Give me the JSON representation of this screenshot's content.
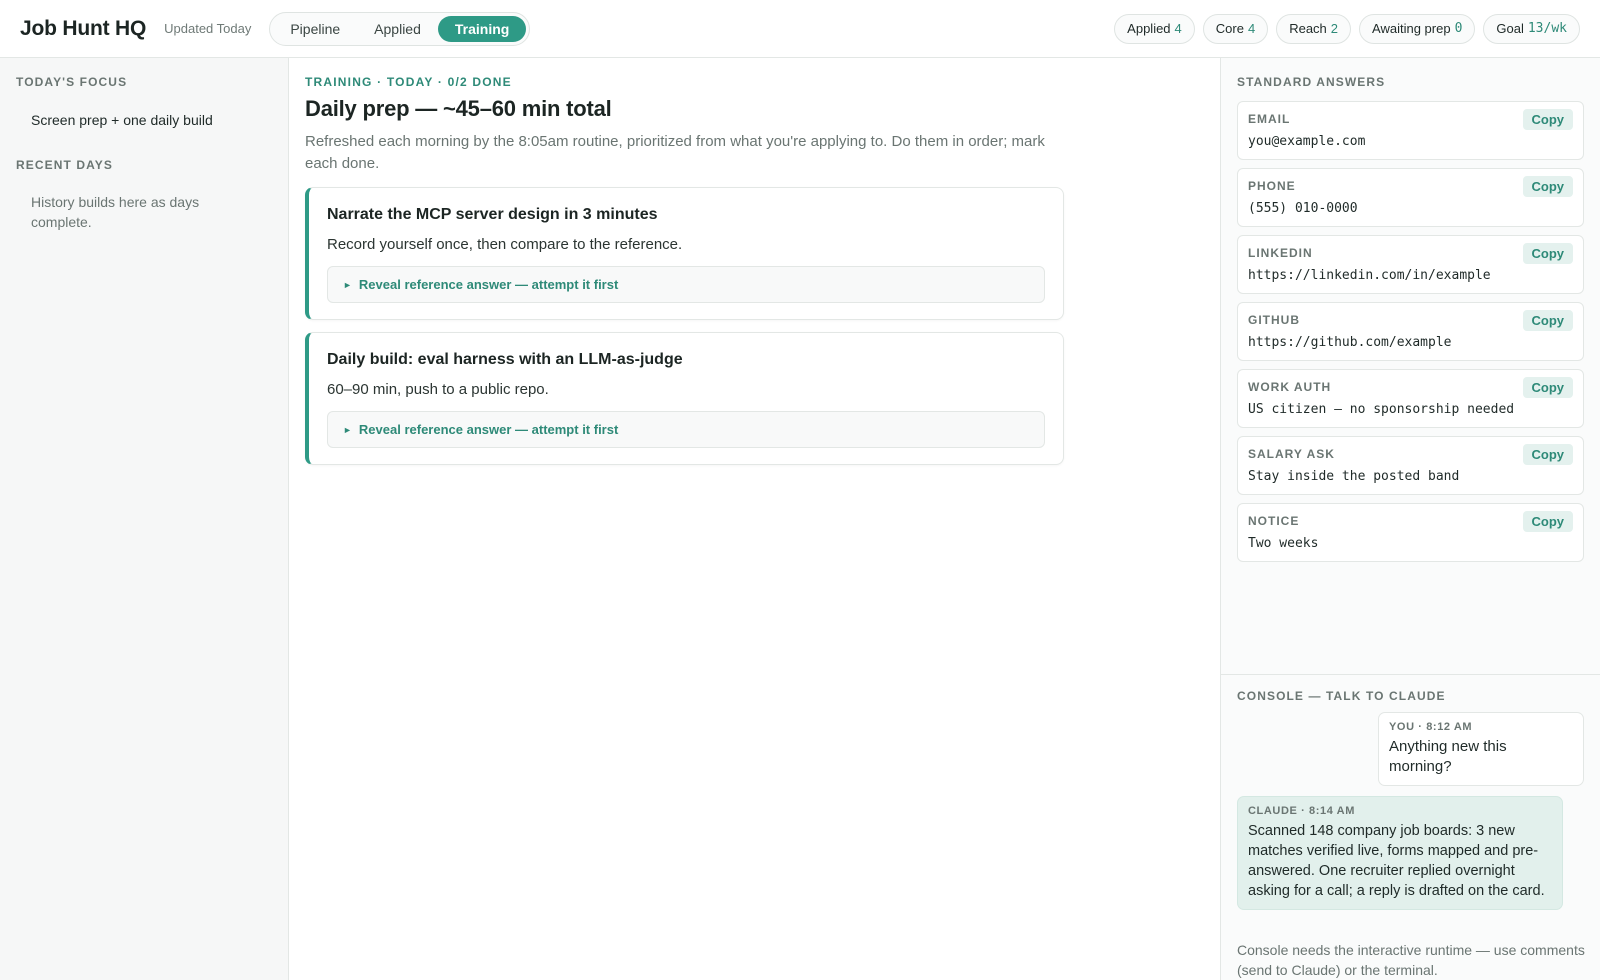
{
  "header": {
    "title": "Job Hunt HQ",
    "updated": "Updated Today",
    "tabs": [
      {
        "label": "Pipeline"
      },
      {
        "label": "Applied"
      },
      {
        "label": "Training",
        "active": true
      }
    ],
    "stats": [
      {
        "label": "Applied",
        "value": "4"
      },
      {
        "label": "Core",
        "value": "4"
      },
      {
        "label": "Reach",
        "value": "2"
      },
      {
        "label": "Awaiting prep",
        "value": "0"
      },
      {
        "label": "Goal",
        "value": "13/wk"
      }
    ]
  },
  "left": {
    "focus_label": "TODAY'S FOCUS",
    "focus_text": "Screen prep + one daily build",
    "recent_label": "RECENT DAYS",
    "recent_text": "History builds here as days complete."
  },
  "main": {
    "eyebrow": "TRAINING · TODAY · 0/2 DONE",
    "title": "Daily prep — ~45–60 min total",
    "subtitle": "Refreshed each morning by the 8:05am routine, prioritized from what you're applying to. Do them in order; mark each done.",
    "tasks": [
      {
        "title": "Narrate the MCP server design in 3 minutes",
        "desc": "Record yourself once, then compare to the reference.",
        "reveal": "Reveal reference answer — attempt it first"
      },
      {
        "title": "Daily build: eval harness with an LLM-as-judge",
        "desc": "60–90 min, push to a public repo.",
        "reveal": "Reveal reference answer — attempt it first"
      }
    ]
  },
  "answers": {
    "label": "STANDARD ANSWERS",
    "copy_label": "Copy",
    "items": [
      {
        "label": "EMAIL",
        "value": "you@example.com"
      },
      {
        "label": "PHONE",
        "value": "(555) 010-0000"
      },
      {
        "label": "LINKEDIN",
        "value": "https://linkedin.com/in/example"
      },
      {
        "label": "GITHUB",
        "value": "https://github.com/example"
      },
      {
        "label": "WORK AUTH",
        "value": "US citizen — no sponsorship needed"
      },
      {
        "label": "SALARY ASK",
        "value": "Stay inside the posted band"
      },
      {
        "label": "NOTICE",
        "value": "Two weeks"
      }
    ]
  },
  "console": {
    "label": "CONSOLE — TALK TO CLAUDE",
    "you_meta": "YOU · 8:12 AM",
    "you_text": "Anything new this morning?",
    "claude_meta": "CLAUDE · 8:14 AM",
    "claude_text": "Scanned 148 company job boards: 3 new matches verified live, forms mapped and pre-answered. One recruiter replied overnight asking for a call; a reply is drafted on the card.",
    "note": "Console needs the interactive runtime — use comments (send to Claude) or the terminal."
  },
  "colors": {
    "accent": "#2e9a86",
    "accent_text": "#2e8a78",
    "claude_bubble": "#e2f0ec"
  },
  "icons": {
    "reveal_caret": "caret-right-icon"
  }
}
